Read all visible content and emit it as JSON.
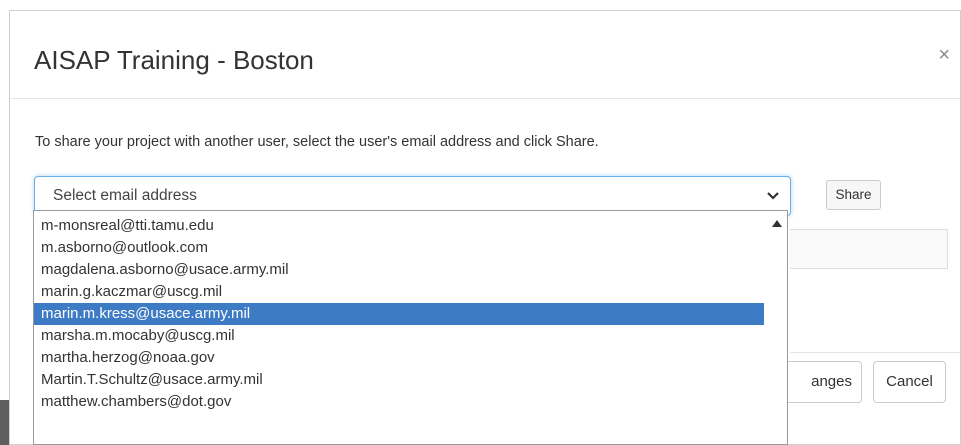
{
  "modal": {
    "title": "AISAP Training - Boston",
    "close_label": "×"
  },
  "share": {
    "instruction": "To share your project with another user, select the user's email address and click Share.",
    "select_placeholder": "Select email address",
    "button_label": "Share"
  },
  "dropdown": {
    "selected_index": 4,
    "options": [
      "m-monsreal@tti.tamu.edu",
      "m.asborno@outlook.com",
      "magdalena.asborno@usace.army.mil",
      "marin.g.kaczmar@uscg.mil",
      "marin.m.kress@usace.army.mil",
      "marsha.m.mocaby@uscg.mil",
      "martha.herzog@noaa.gov",
      "Martin.T.Schultz@usace.army.mil",
      "matthew.chambers@dot.gov"
    ]
  },
  "footer": {
    "save_label": "anges",
    "cancel_label": "Cancel"
  },
  "icons": {
    "close": "close-icon",
    "select_arrow": "chevron-down-icon",
    "scroll_up": "scroll-up-arrow-icon"
  }
}
